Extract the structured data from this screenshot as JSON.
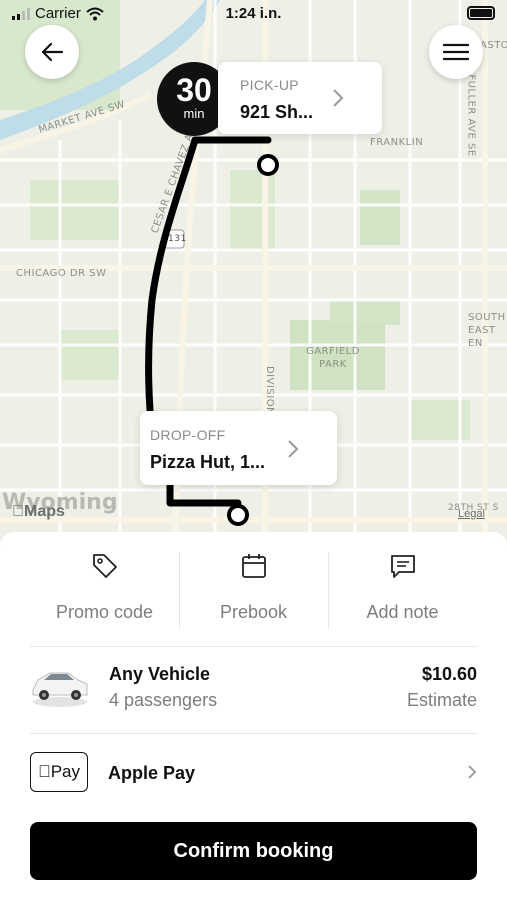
{
  "status_bar": {
    "carrier": "Carrier",
    "time": "1:24 i.n."
  },
  "map": {
    "labels": {
      "market_ave": "MARKET AVE SW",
      "cesar_chavez": "CESAR E CHAVEZ AV",
      "chicago_dr": "CHICAGO DR SW",
      "franklin": "FRANKLIN",
      "fuller_ave": "FULLER AVE SE",
      "garfield_park": "GARFIELD PARK",
      "division": "DIVISION",
      "south_east_end": "SOUTH EAST EN",
      "east_top": "ASTOW",
      "route_131": "131",
      "wyoming": "Wyoming",
      "street_28th": "28TH ST S"
    },
    "brand": "Maps",
    "legal": "Legal",
    "eta": {
      "value": "30",
      "unit": "min"
    },
    "pickup": {
      "label": "PICK-UP",
      "value": "921 Sh..."
    },
    "dropoff": {
      "label": "DROP-OFF",
      "value": "Pizza Hut, 1..."
    }
  },
  "actions": [
    {
      "label": "Promo code",
      "icon": "tag-icon"
    },
    {
      "label": "Prebook",
      "icon": "calendar-icon"
    },
    {
      "label": "Add note",
      "icon": "note-icon"
    }
  ],
  "vehicle": {
    "name": "Any Vehicle",
    "passengers": "4 passengers",
    "price": "$10.60",
    "price_note": "Estimate"
  },
  "payment": {
    "badge": "Pay",
    "name": "Apple Pay"
  },
  "confirm_label": "Confirm booking",
  "colors": {
    "primary": "#000000",
    "secondary_text": "#7d7d7d",
    "map_bg": "#eef0e8",
    "park": "#cfe3c2",
    "water": "#bfdce9"
  }
}
